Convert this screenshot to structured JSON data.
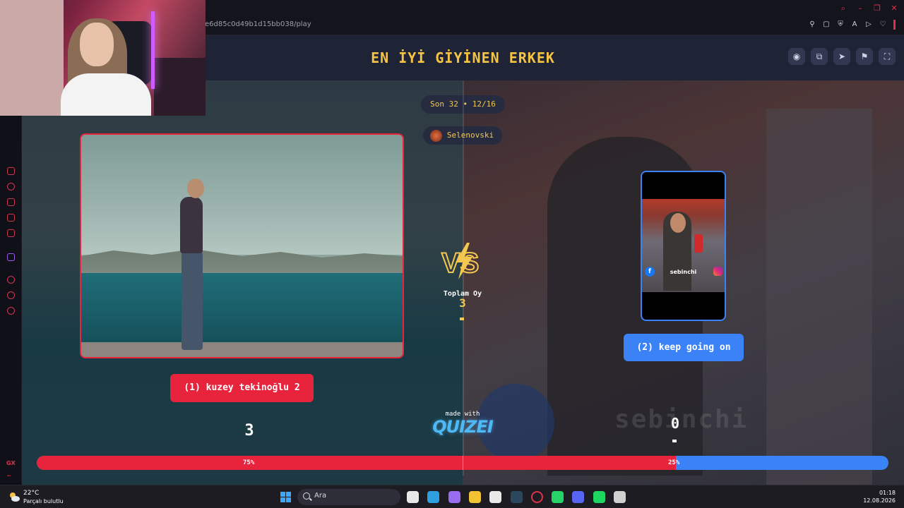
{
  "browser": {
    "url": "e6d85c0d49b1d15bb038/play"
  },
  "quiz": {
    "title": "EN İYİ GİYİNEN ERKEK",
    "round": "Son 32 • 12/16",
    "creator": "Selenovski",
    "header_buttons": [
      {
        "icon": "eye-icon",
        "glyph": "◉"
      },
      {
        "icon": "copy-icon",
        "glyph": "⧉"
      },
      {
        "icon": "send-icon",
        "glyph": "➤"
      },
      {
        "icon": "flag-icon",
        "glyph": "⚑"
      },
      {
        "icon": "fullscreen-icon",
        "glyph": "⛶"
      }
    ],
    "left": {
      "label": "(1) kuzey tekinoğlu 2",
      "score": "3",
      "percent": "75%",
      "share": 0.75,
      "color": "#e8233c"
    },
    "right": {
      "label": "(2) keep going on",
      "score": "0",
      "percent": "25%",
      "share": 0.25,
      "color": "#3b82f6",
      "video_caption": "sebinchi",
      "video_badge": "f"
    },
    "vs": {
      "text": "VS",
      "total_label": "Toplam Oy",
      "total_value": "3"
    },
    "footer": {
      "made_with": "made with",
      "brand": "QUIZEI"
    }
  },
  "sidebar": {
    "gx_label": "GX",
    "more": "⋯"
  },
  "taskbar": {
    "temperature": "22°C",
    "weather": "Parçalı bulutlu",
    "search_placeholder": "Ara",
    "time": "01:18",
    "date": "12.08.2026",
    "apps": [
      {
        "name": "task-view",
        "color": "#e8e8e8"
      },
      {
        "name": "edge",
        "color": "#2f9fe0"
      },
      {
        "name": "copilot",
        "color": "#9a6cf0"
      },
      {
        "name": "file-explorer",
        "color": "#f2c233"
      },
      {
        "name": "store",
        "color": "#e9e9e9"
      },
      {
        "name": "steam",
        "color": "#2a475e"
      },
      {
        "name": "opera-gx",
        "color": "#e0304a"
      },
      {
        "name": "whatsapp",
        "color": "#25d366"
      },
      {
        "name": "discord",
        "color": "#5865f2"
      },
      {
        "name": "spotify",
        "color": "#1ed760"
      },
      {
        "name": "chrome",
        "color": "#d0d0d0"
      }
    ]
  }
}
